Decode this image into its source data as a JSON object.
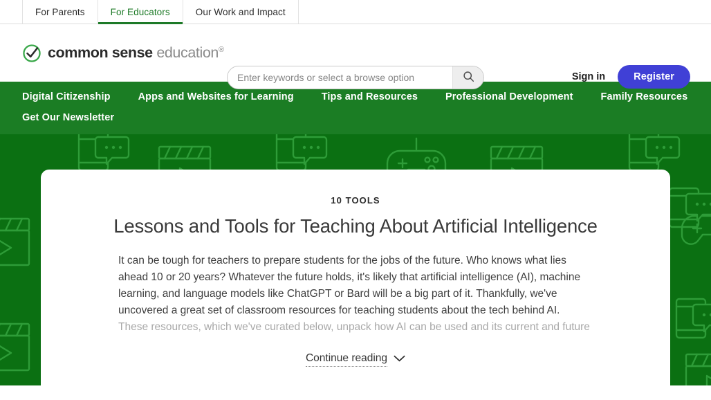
{
  "colors": {
    "nav_green": "#1b7d24",
    "hero_green": "#0b7012",
    "register_purple": "#4040d6",
    "active_tab_green": "#1d7a27"
  },
  "tabstrip": {
    "tabs": [
      {
        "label": "For Parents",
        "active": false
      },
      {
        "label": "For Educators",
        "active": true
      },
      {
        "label": "Our Work and Impact",
        "active": false
      }
    ]
  },
  "header": {
    "logo": {
      "icon": "check-circle-icon",
      "bold_text": "common sense",
      "light_text": "education",
      "registered_mark": "®"
    },
    "search": {
      "placeholder": "Enter keywords or select a browse option",
      "value": "",
      "button_icon": "search-icon"
    },
    "sign_in_label": "Sign in",
    "register_label": "Register"
  },
  "green_nav": {
    "items": [
      "Digital Citizenship",
      "Apps and Websites for Learning",
      "Tips and Resources",
      "Professional Development",
      "Family Resources",
      "Get Our Newsletter"
    ]
  },
  "hero": {
    "pattern_icons": [
      "device-chat-icon",
      "clapperboard-icon",
      "game-controller-icon"
    ],
    "card": {
      "eyebrow": "10 TOOLS",
      "title": "Lessons and Tools for Teaching About Artificial Intelligence",
      "paragraph": "It can be tough for teachers to prepare students for the jobs of the future. Who knows what lies ahead 10 or 20 years? Whatever the future holds, it's likely that artificial intelligence (AI), machine learning, and language models like ChatGPT or Bard will be a big part of it. Thankfully, we've uncovered a great set of classroom resources for teaching students about the tech behind AI.",
      "paragraph_faded": "These resources, which we've curated below, unpack how AI can be used and its current and future",
      "continue_label": "Continue reading",
      "continue_icon": "chevron-down-icon"
    }
  }
}
